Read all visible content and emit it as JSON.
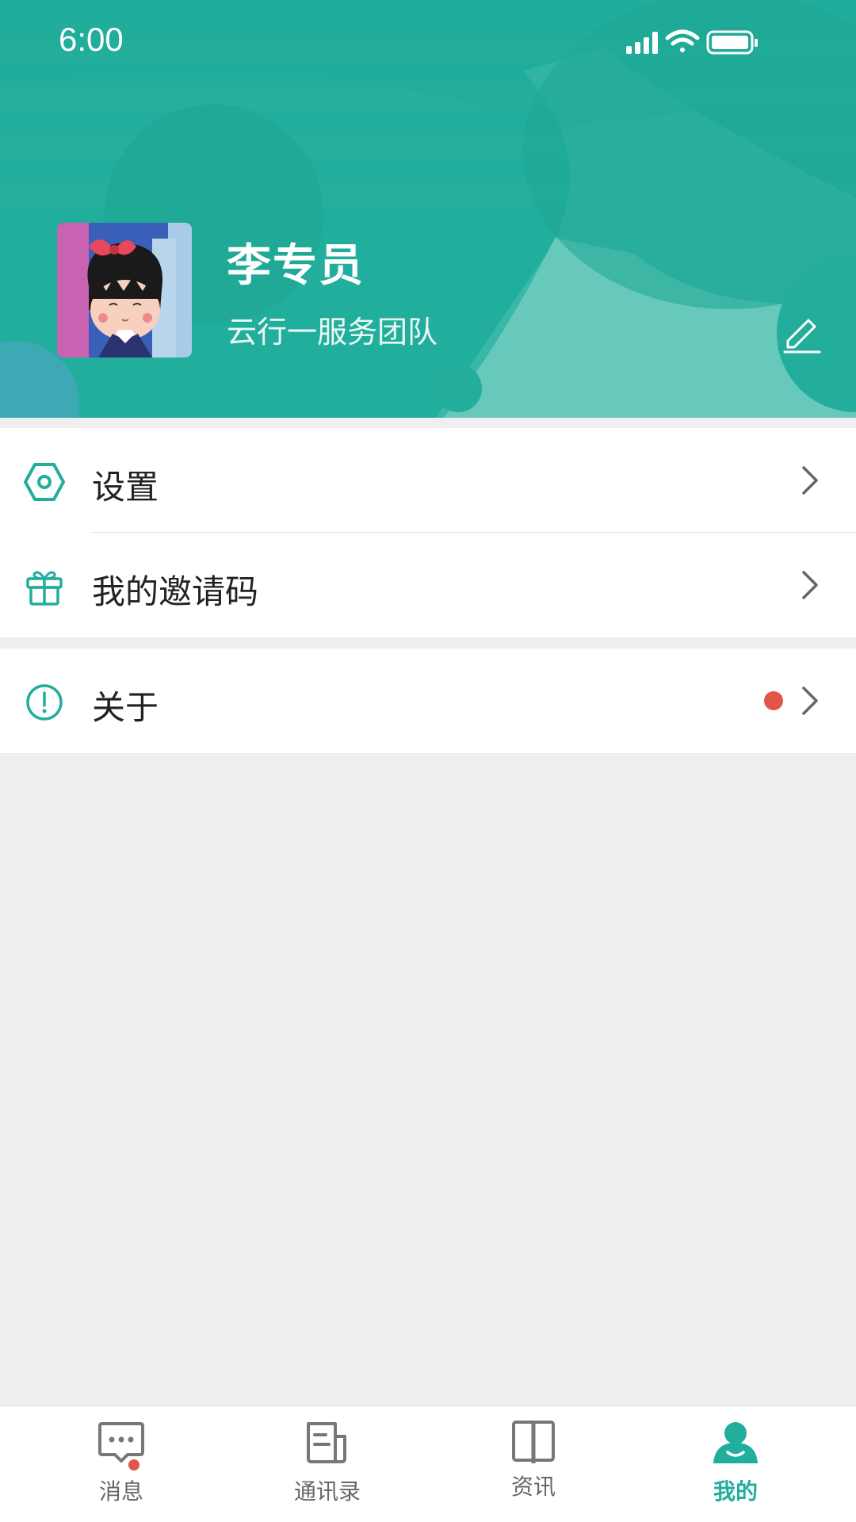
{
  "status_bar": {
    "time": "6:00"
  },
  "profile": {
    "name": "李专员",
    "team": "云行一服务团队"
  },
  "menu": {
    "settings_label": "设置",
    "invite_label": "我的邀请码",
    "about_label": "关于"
  },
  "tabs": [
    {
      "label": "消息",
      "icon": "message-icon"
    },
    {
      "label": "通讯录",
      "icon": "contacts-icon"
    },
    {
      "label": "资讯",
      "icon": "book-icon"
    },
    {
      "label": "我的",
      "icon": "person-icon"
    }
  ],
  "colors": {
    "accent": "#22ae9c",
    "badge": "#e0564a",
    "background": "#efefef"
  }
}
